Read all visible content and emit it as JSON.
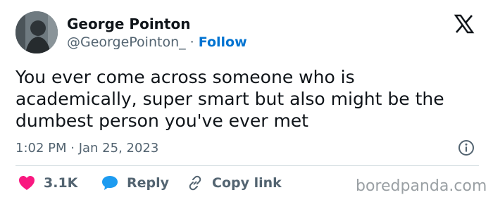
{
  "author": {
    "name": "George Pointon",
    "handle": "@GeorgePointon_",
    "separator": " · ",
    "follow_label": "Follow"
  },
  "tweet": {
    "text": "You ever come across someone who is academically, super smart but also might be the dumbest person you've ever met",
    "timestamp": "1:02 PM · Jan 25, 2023"
  },
  "actions": {
    "like_count": "3.1K",
    "reply_label": "Reply",
    "copy_link_label": "Copy link"
  },
  "watermark": "boredpanda.com",
  "icons": {
    "platform": "x-logo-icon",
    "info": "info-icon",
    "like": "heart-icon",
    "reply": "speech-bubble-icon",
    "copy": "link-icon"
  },
  "colors": {
    "follow": "#0073d1",
    "like": "#f91880",
    "reply": "#1d9bf0",
    "muted_text": "#536471"
  }
}
